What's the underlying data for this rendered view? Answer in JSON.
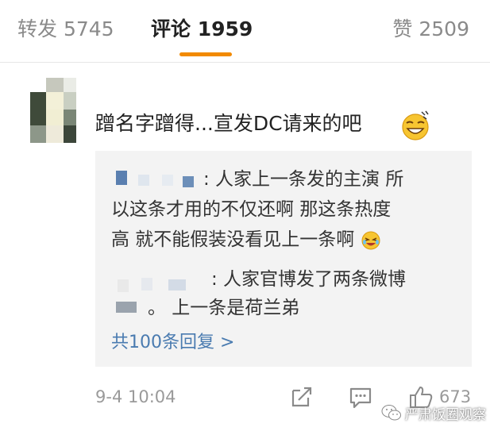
{
  "tabs": {
    "repost_label": "转发 5745",
    "comment_label": "评论 1959",
    "like_label": "赞 2509"
  },
  "comment": {
    "text": "蹭名字蹭得...宣发DC请来的吧",
    "emoji": "grinning-sweat-emoji"
  },
  "replies": {
    "line1": ": 人家上一条发的主演 所",
    "line2": "以这条才用的不仅还啊 那这条热度",
    "line3": "高 就不能假装没看见上一条啊",
    "line4": ": 人家官博发了两条微博",
    "line5": "。 上一条是荷兰弟",
    "more_label": "共100条回复 >"
  },
  "footer": {
    "timestamp": "9-4 10:04",
    "like_count": "673"
  },
  "watermark": {
    "text": "严肃饭圈观察"
  },
  "colors": {
    "accent": "#f28a00",
    "link": "#4a7bb0",
    "reply_bg": "#f3f3f3",
    "muted": "#9a9a9a"
  }
}
